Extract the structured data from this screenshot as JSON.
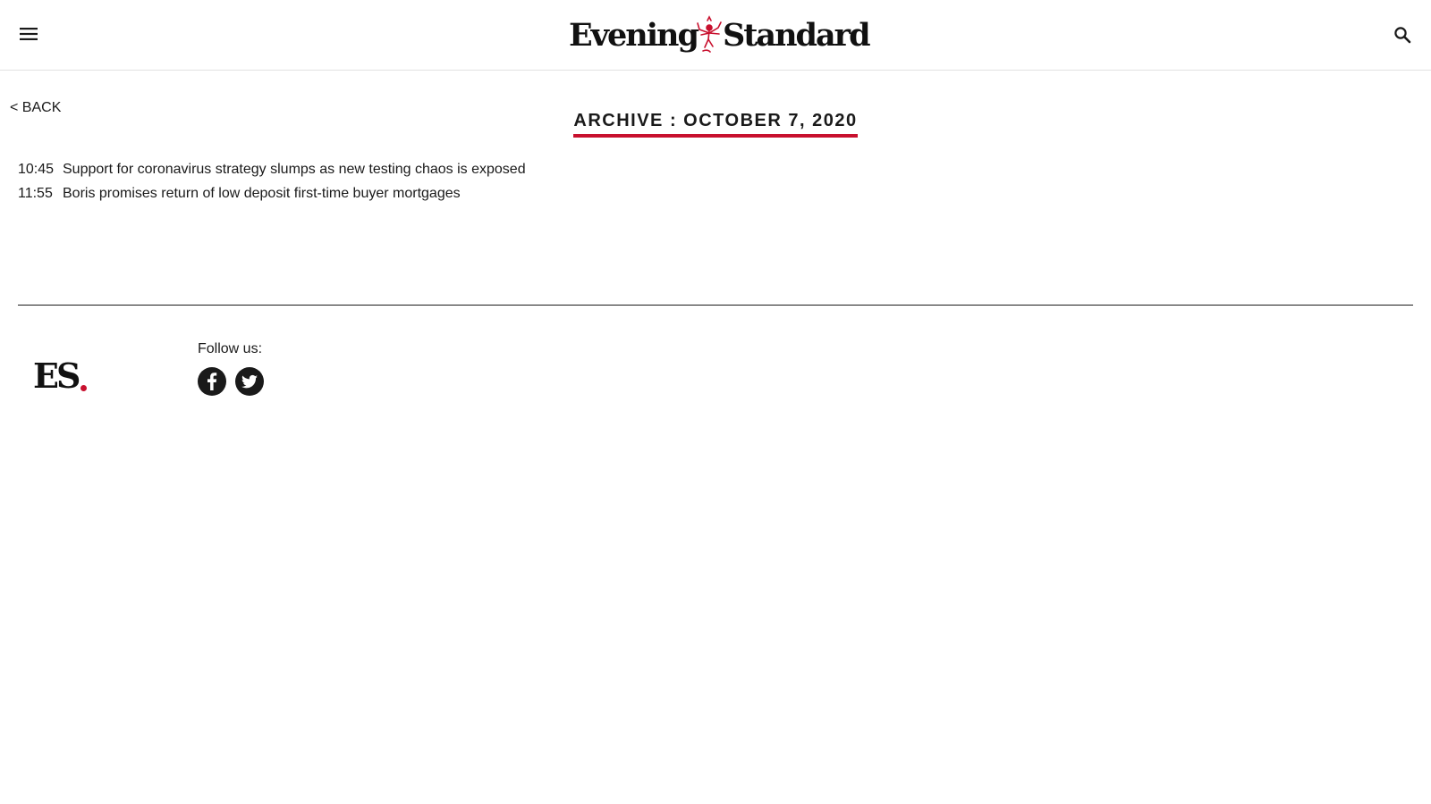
{
  "header": {
    "menu_icon": "hamburger-menu-icon",
    "logo_left": "Evening",
    "logo_right": "Standard",
    "logo_mark_icon": "cherub-icon",
    "search_icon": "magnifier-search-icon"
  },
  "nav": {
    "back_label": "< BACK"
  },
  "archive": {
    "title": "ARCHIVE : OCTOBER 7, 2020",
    "underline_color": "#c8102e"
  },
  "articles": [
    {
      "time": "10:45",
      "headline": "Support for coronavirus strategy slumps as new testing chaos is exposed"
    },
    {
      "time": "11:55",
      "headline": "Boris promises return of low deposit first-time buyer mortgages"
    }
  ],
  "footer": {
    "logo_text": "ES",
    "logo_dot_color": "#c8102e",
    "follow_label": "Follow us:",
    "social": [
      {
        "icon": "facebook-icon"
      },
      {
        "icon": "twitter-icon"
      }
    ]
  },
  "colors": {
    "brand_red": "#c8102e",
    "text": "#1a1a1a",
    "header_border": "#e2e2e2"
  }
}
